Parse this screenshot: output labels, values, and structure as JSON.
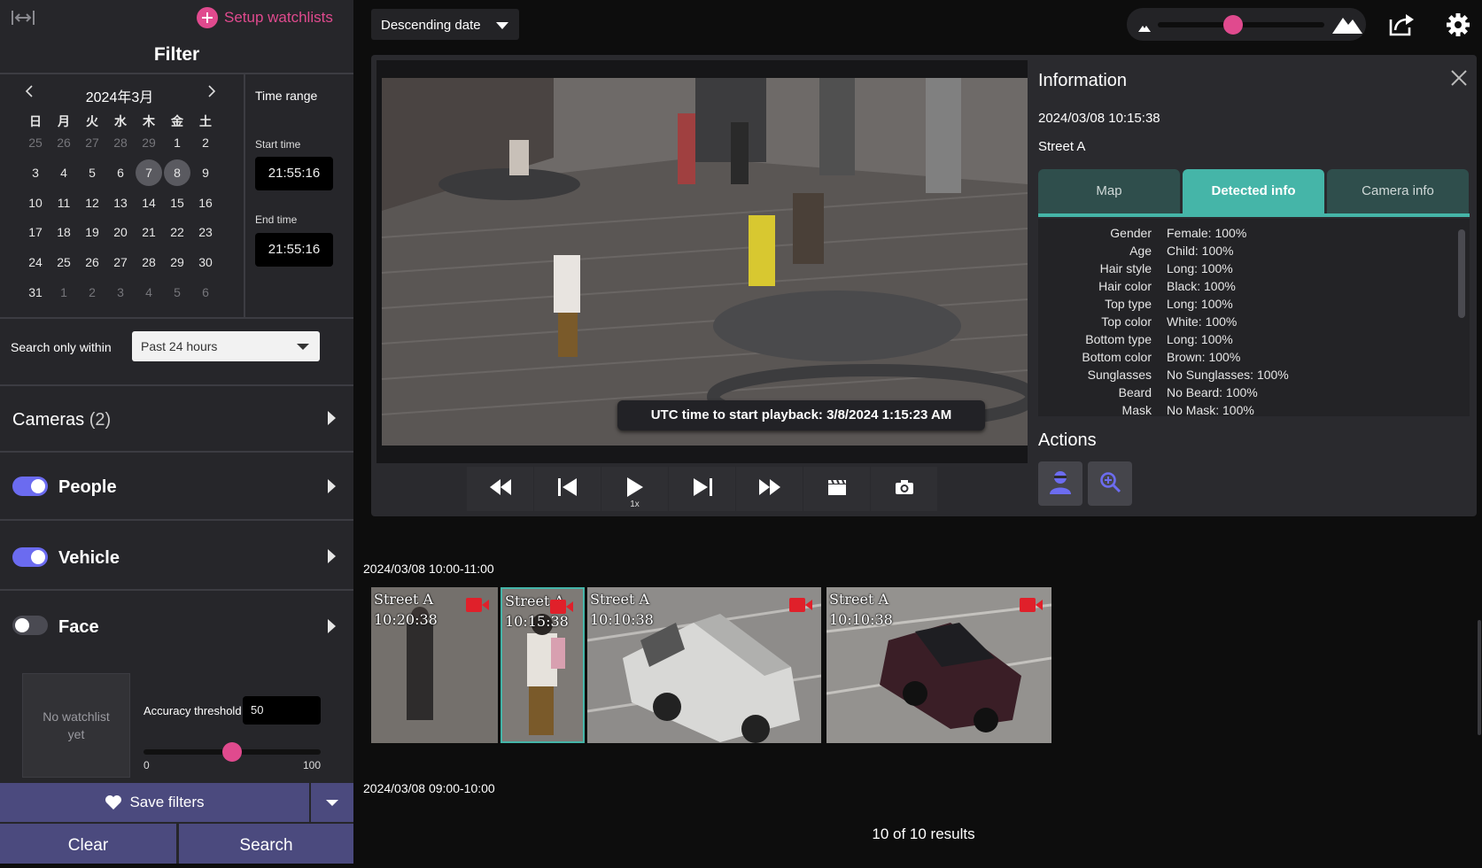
{
  "sidebar": {
    "setup_watchlists": "Setup watchlists",
    "filter_title": "Filter",
    "calendar": {
      "month_label": "2024年3月",
      "weekdays": [
        "日",
        "月",
        "火",
        "水",
        "木",
        "金",
        "土"
      ],
      "weeks": [
        [
          "25",
          "26",
          "27",
          "28",
          "29",
          "1",
          "2"
        ],
        [
          "3",
          "4",
          "5",
          "6",
          "7",
          "8",
          "9"
        ],
        [
          "10",
          "11",
          "12",
          "13",
          "14",
          "15",
          "16"
        ],
        [
          "17",
          "18",
          "19",
          "20",
          "21",
          "22",
          "23"
        ],
        [
          "24",
          "25",
          "26",
          "27",
          "28",
          "29",
          "30"
        ],
        [
          "31",
          "1",
          "2",
          "3",
          "4",
          "5",
          "6"
        ]
      ],
      "selected": [
        "7",
        "8"
      ]
    },
    "time_range": {
      "title": "Time range",
      "start_label": "Start time",
      "start_value": "21:55:16",
      "end_label": "End time",
      "end_value": "21:55:16"
    },
    "search_within_label": "Search only within",
    "search_within_value": "Past 24 hours",
    "cameras_label": "Cameras",
    "cameras_count": "(2)",
    "people_label": "People",
    "people_on": true,
    "vehicle_label": "Vehicle",
    "vehicle_on": true,
    "face_label": "Face",
    "face_on": false,
    "no_watchlist": "No watchlist yet",
    "accuracy_label": "Accuracy threshold",
    "accuracy_value": "50",
    "slider_min": "0",
    "slider_max": "100",
    "slider_level": 0.5,
    "save_filters": "Save filters",
    "clear": "Clear",
    "search": "Search"
  },
  "toolbar": {
    "sort_value": "Descending date",
    "zoom_level": 0.45
  },
  "player": {
    "playback_banner": "UTC time to start playback: 3/8/2024 1:15:23 AM",
    "speed": "1x"
  },
  "info": {
    "title": "Information",
    "datetime": "2024/03/08 10:15:38",
    "camera": "Street A",
    "tabs": [
      "Map",
      "Detected info",
      "Camera info"
    ],
    "active_tab": 1,
    "rows": [
      {
        "key": "Gender",
        "value": "Female: 100%"
      },
      {
        "key": "Age",
        "value": "Child: 100%"
      },
      {
        "key": "Hair style",
        "value": "Long: 100%"
      },
      {
        "key": "Hair color",
        "value": "Black: 100%"
      },
      {
        "key": "Top type",
        "value": "Long: 100%"
      },
      {
        "key": "Top color",
        "value": "White: 100%"
      },
      {
        "key": "Bottom type",
        "value": "Long: 100%"
      },
      {
        "key": "Bottom color",
        "value": "Brown: 100%"
      },
      {
        "key": "Sunglasses",
        "value": "No Sunglasses: 100%"
      },
      {
        "key": "Beard",
        "value": "No Beard: 100%"
      },
      {
        "key": "Mask",
        "value": "No Mask: 100%"
      }
    ],
    "actions_title": "Actions"
  },
  "results": {
    "group1_label": "2024/03/08 10:00-11:00",
    "group2_label": "2024/03/08 09:00-10:00",
    "thumbnails": [
      {
        "camera": "Street A",
        "time": "10:20:38"
      },
      {
        "camera": "Street A",
        "time": "10:15:38"
      },
      {
        "camera": "Street A",
        "time": "10:10:38"
      },
      {
        "camera": "Street A",
        "time": "10:10:38"
      }
    ],
    "count_text": "10 of 10 results"
  },
  "colors": {
    "accent_pink": "#e04a8e",
    "toggle_on": "#6b6bf0",
    "tab_active": "#45b5a8",
    "tab_inactive": "#2f4e4c",
    "save_bar": "#4b4a7e",
    "record_red": "#e0202a"
  }
}
